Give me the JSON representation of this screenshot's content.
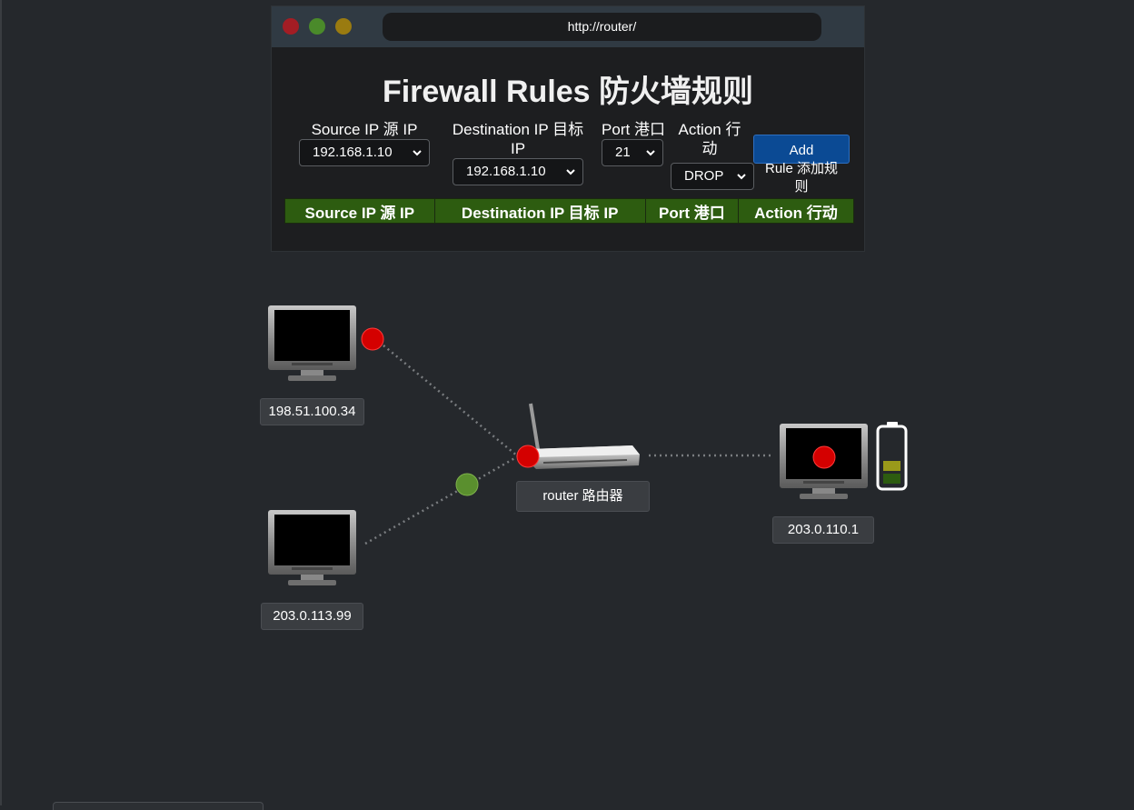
{
  "browser": {
    "url": "http://router/"
  },
  "firewall": {
    "title": "Firewall Rules  防火墙规则",
    "fields": {
      "source_label": "Source IP  源 IP",
      "source_value": "192.168.1.10",
      "dest_label_line1": "Destination IP  目标",
      "dest_label_line2": "IP",
      "dest_value": "192.168.1.10",
      "port_label": "Port  港口",
      "port_value": "21",
      "action_label_line1": "Action  行",
      "action_label_line2": "动",
      "action_value": "DROP"
    },
    "add_button": {
      "line1": "Add",
      "line2": "Rule  添加规",
      "line3": "则"
    },
    "table": {
      "headers": [
        "Source IP  源 IP",
        "Destination IP  目标 IP",
        "Port  港口",
        "Action  行动"
      ],
      "rows": []
    }
  },
  "network": {
    "hosts": [
      {
        "ip": "198.51.100.34",
        "status": "blocked"
      },
      {
        "ip": "203.0.113.99",
        "status": "allowed"
      },
      {
        "ip": "203.0.110.1",
        "status": "blocked"
      }
    ],
    "router_label": "router  路由器",
    "battery": {
      "level": 0.4
    }
  },
  "colors": {
    "background": "#25282c",
    "titlebar": "#303a43",
    "table_header": "#2d5c10",
    "button": "#0b4a94",
    "status_blocked": "#d40000",
    "status_allowed": "#5a8f2e",
    "battery_mid": "#9a9a1a",
    "battery_low": "#2d5c10"
  }
}
